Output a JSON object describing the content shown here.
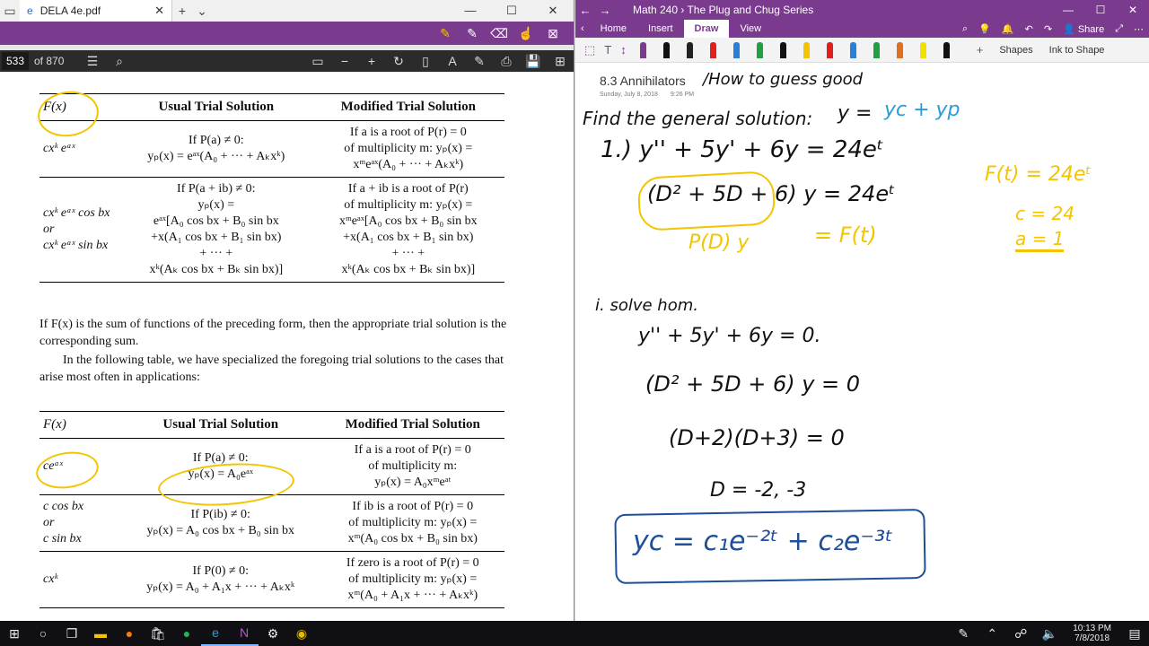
{
  "pdf": {
    "tab_title": "DELA 4e.pdf",
    "page_number": "533",
    "page_total": "of 870",
    "table1": {
      "headers": [
        "F(x)",
        "Usual Trial Solution",
        "Modified Trial Solution"
      ],
      "rows": [
        {
          "fx": "cxᵏ eᵃˣ",
          "usual": [
            "If P(a) ≠ 0:",
            "yₚ(x) = eᵃˣ(A₀ + ··· + Aₖxᵏ)"
          ],
          "modified": [
            "If a is a root of P(r) = 0",
            "of multiplicity m: yₚ(x) =",
            "xᵐeᵃˣ(A₀ + ··· + Aₖxᵏ)"
          ]
        },
        {
          "fx": "cxᵏ eᵃˣ cos bx\nor\ncxᵏ eᵃˣ sin bx",
          "usual": [
            "If P(a + ib) ≠ 0:",
            "yₚ(x) =",
            "eᵃˣ[A₀ cos bx + B₀ sin bx",
            "+x(A₁ cos bx + B₁ sin bx)",
            "+ ··· +",
            "xᵏ(Aₖ cos bx + Bₖ sin bx)]"
          ],
          "modified": [
            "If a + ib is a root of P(r)",
            "of multiplicity m: yₚ(x) =",
            "xᵐeᵃˣ[A₀ cos bx + B₀ sin bx",
            "+x(A₁ cos bx + B₁ sin bx)",
            "+ ··· +",
            "xᵏ(Aₖ cos bx + Bₖ sin bx)]"
          ]
        }
      ]
    },
    "para1": "If F(x) is the sum of functions of the preceding form, then the appropriate trial solution is the corresponding sum.",
    "para2": "In the following table, we have specialized the foregoing trial solutions to the cases that arise most often in applications:",
    "table2": {
      "headers": [
        "F(x)",
        "Usual Trial Solution",
        "Modified Trial Solution"
      ],
      "rows": [
        {
          "fx": "ceᵃˣ",
          "usual": [
            "If P(a) ≠ 0:",
            "yₚ(x) = A₀eᵃˣ"
          ],
          "modified": [
            "If a is a root of P(r) = 0",
            "of multiplicity m:",
            "yₚ(x) = A₀xᵐeᵃᵗ"
          ]
        },
        {
          "fx": "c cos bx\nor\nc sin bx",
          "usual": [
            "If P(ib) ≠ 0:",
            "yₚ(x) = A₀ cos bx + B₀ sin bx"
          ],
          "modified": [
            "If ib is a root of P(r) = 0",
            "of multiplicity m: yₚ(x) =",
            "xᵐ(A₀ cos bx + B₀ sin bx)"
          ]
        },
        {
          "fx": "cxᵏ",
          "usual": [
            "If P(0) ≠ 0:",
            "yₚ(x) = A₀ + A₁x + ··· + Aₖxᵏ"
          ],
          "modified": [
            "If zero is a root of P(r) = 0",
            "of multiplicity m: yₚ(x) =",
            "xᵐ(A₀ + A₁x + ··· + Aₖxᵏ)"
          ]
        }
      ]
    }
  },
  "onenote": {
    "window_title": "Math 240 › The Plug and Chug Series",
    "tabs": [
      "Home",
      "Insert",
      "Draw",
      "View"
    ],
    "active_tab": "Draw",
    "share_label": "Share",
    "shapes_label": "Shapes",
    "ink_to_shape_label": "Ink to Shape",
    "page_title": "8.3 Annihilators",
    "page_date": "Sunday, July 8, 2018",
    "page_time": "9:26 PM",
    "pen_colors": [
      "#7a3b8f",
      "#111111",
      "#222222",
      "#e02020",
      "#2a7fd8",
      "#20a040",
      "#111111",
      "#f2c500",
      "#e02020",
      "#2a7fd8",
      "#20a040",
      "#e07020",
      "#f2e000",
      "#111111"
    ],
    "ink": {
      "title_note": "/How to guess good",
      "find": "Find the general solution:",
      "y_eq": "y =",
      "yc_yp": "yc + yp",
      "eq1": "1.) y'' + 5y' + 6y = 24eᵗ",
      "eq2": "(D² + 5D + 6) y = 24eᵗ",
      "pdy": "P(D) y",
      "eq_ft": "= F(t)",
      "ft": "F(t) = 24eᵗ",
      "c_val": "c = 24",
      "a_val": "a = 1",
      "i_solve": "i. solve hom.",
      "hom": "y'' + 5y' + 6y = 0.",
      "hom2": "(D² + 5D + 6) y = 0",
      "factor": "(D+2)(D+3) = 0",
      "roots": "D = -2, -3",
      "yc": "yc = c₁e⁻²ᵗ + c₂e⁻³ᵗ"
    }
  },
  "taskbar": {
    "time": "10:13 PM",
    "date": "7/8/2018"
  }
}
